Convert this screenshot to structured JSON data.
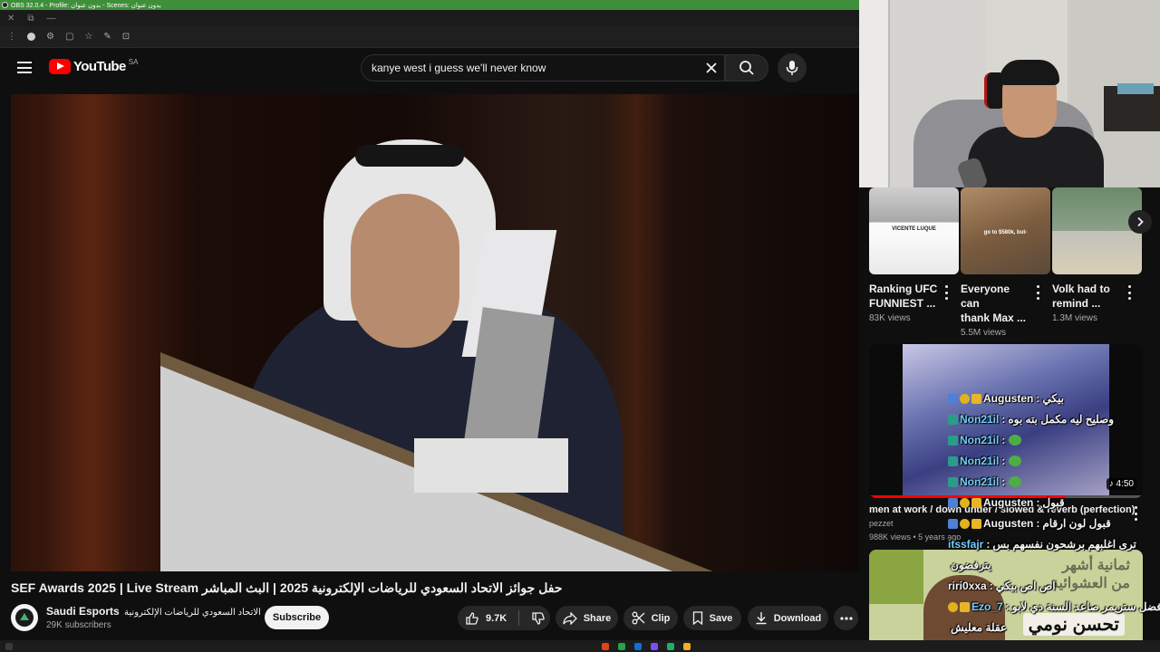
{
  "obs": {
    "title": "OBS 32.0.4 - Profile: بدون عنوان - Scenes: بدون عنوان"
  },
  "youtube": {
    "logo_text": "YouTube",
    "country_code": "SA",
    "search_query": "kanye west i guess we'll never know"
  },
  "video": {
    "title": "SEF Awards 2025 | Live Stream حفل جوائز الاتحاد السعودي للرياضات الإلكترونية 2025 | البث المباشر",
    "channel_name": "Saudi Esports",
    "channel_name_ar": "الاتحاد السعودي للرياضات الإلكترونية",
    "subscribers": "29K subscribers",
    "subscribe_label": "Subscribe",
    "likes": "9.7K",
    "share_label": "Share",
    "clip_label": "Clip",
    "save_label": "Save",
    "download_label": "Download"
  },
  "shorts": [
    {
      "title": "Ranking UFC\nFUNNIEST ...",
      "views": "83K views",
      "thumb_caption": "VICENTE LUQUE"
    },
    {
      "title": "Everyone can\nthank Max ...",
      "views": "5.5M views",
      "thumb_caption": "go to $580k, but-"
    },
    {
      "title": "Volk had to\nremind ...",
      "views": "1.3M views"
    }
  ],
  "recommended": [
    {
      "title": "men at work / down under / slowed & reverb (perfection)",
      "channel": "pezzet",
      "meta": "988K views • 5 years ago",
      "duration": "4:50",
      "progress": 0.72
    },
    {
      "thumb_text_top": "ثمانية أشهر\nمن العشوائية",
      "thumb_text_big": "تحسن نومي"
    }
  ],
  "chat": [
    {
      "user": "Augusten",
      "msg": "بيكي",
      "badges": [
        "blue",
        "gold",
        "crown"
      ],
      "color": "white"
    },
    {
      "user": "Non21il",
      "msg": "وصليح ليه مكمل بته بوه",
      "badges": [
        "teal"
      ],
      "color": "teal"
    },
    {
      "user": "Non21il",
      "msg": "",
      "badges": [
        "teal"
      ],
      "color": "teal",
      "emote": true
    },
    {
      "user": "Non21il",
      "msg": "",
      "badges": [
        "teal"
      ],
      "color": "teal",
      "emote": true
    },
    {
      "user": "Non21il",
      "msg": "",
      "badges": [
        "teal"
      ],
      "color": "teal",
      "emote": true
    },
    {
      "user": "Augusten",
      "msg": "قبول",
      "badges": [
        "blue",
        "gold",
        "crown"
      ],
      "color": "white"
    },
    {
      "user": "Augusten",
      "msg": "قبول لون ارقام",
      "badges": [
        "blue",
        "gold",
        "crown"
      ],
      "color": "white"
    },
    {
      "user": "itssfajr",
      "msg": "ترى اغلبهم برشحون نفسهم بس",
      "badges": [],
      "color": "teal"
    },
    {
      "user": "",
      "msg": "يترفضون",
      "badges": [],
      "color": "white"
    },
    {
      "user": "riri0xxa",
      "msg": "اص اص بيكي",
      "badges": [],
      "color": "white"
    },
    {
      "user": "Ezo_7",
      "msg": "افضل ستريمر صاعد السنة دي لابو",
      "badges": [
        "gold",
        "crown"
      ],
      "color": "teal"
    },
    {
      "user": "",
      "msg": "عقلة معليش",
      "badges": [],
      "color": "white"
    },
    {
      "user": "riri0xxa",
      "msg": "",
      "badges": [],
      "color": "white"
    }
  ],
  "colors": {
    "accent": "#ff0000",
    "bg": "#0f0f0f",
    "pill": "#272727",
    "obs_green": "#3f8f3a"
  }
}
